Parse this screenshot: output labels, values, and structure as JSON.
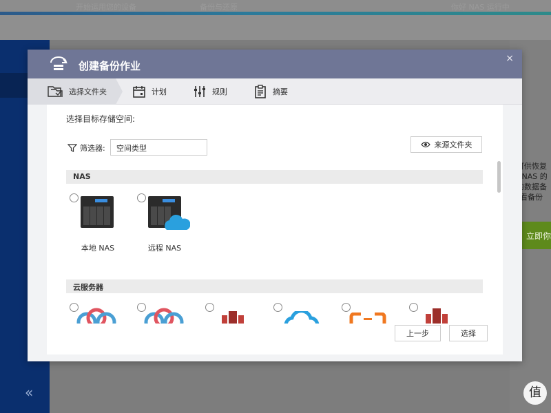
{
  "background": {
    "top_ghost_1": "开始运用您的设备",
    "top_ghost_2": "备份与还原",
    "top_ghost_3": "你好 NAS 运行中",
    "right_lines": [
      "可供恢复",
      "- NAS 的",
      "的数据备",
      "查看备份"
    ],
    "right_button": "立即你",
    "collapse_icon": "«",
    "watermark": "值"
  },
  "modal": {
    "title": "创建备份作业",
    "close": "×",
    "steps": [
      {
        "label": "选择文件夹",
        "icon": "folder-select-icon"
      },
      {
        "label": "计划",
        "icon": "calendar-icon"
      },
      {
        "label": "规则",
        "icon": "sliders-icon"
      },
      {
        "label": "摘要",
        "icon": "clipboard-icon"
      }
    ],
    "prompt": "选择目标存储空间:",
    "filter_label": "筛选器:",
    "filter_value": "空间类型",
    "source_button": "来源文件夹",
    "sections": {
      "nas": "NAS",
      "cloud": "云服务器"
    },
    "nas_options": [
      {
        "label": "本地 NAS"
      },
      {
        "label": "远程 NAS"
      }
    ],
    "back_button": "上一步",
    "select_button": "选择"
  },
  "colors": {
    "header": "#6f7696",
    "sidebar": "#0a2f6e",
    "green_button": "#5e8a1c",
    "cloud_blue": "#2aa0de",
    "aws_red": "#c1403a",
    "orange": "#f07820"
  }
}
